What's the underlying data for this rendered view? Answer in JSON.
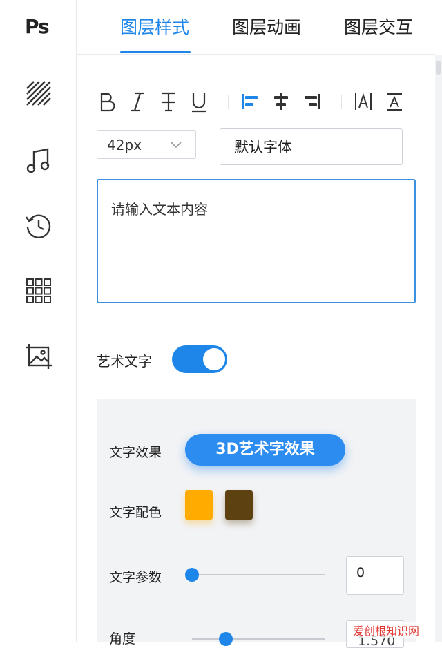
{
  "sidebar": {
    "logo": "Ps",
    "icons": [
      "texture-icon",
      "music-icon",
      "history-icon",
      "grid-icon",
      "image-icon"
    ]
  },
  "tabs": [
    {
      "label": "图层样式",
      "active": true
    },
    {
      "label": "图层动画",
      "active": false
    },
    {
      "label": "图层交互",
      "active": false
    }
  ],
  "toolbar": {
    "buttons": [
      "bold",
      "italic",
      "strikethrough",
      "underline",
      "align-left",
      "align-center",
      "align-right",
      "letter-spacing",
      "line-height"
    ]
  },
  "font": {
    "size": "42px",
    "family": "默认字体"
  },
  "text_input": {
    "placeholder": "请输入文本内容"
  },
  "art_text": {
    "label": "艺术文字",
    "enabled": true
  },
  "panel": {
    "effect_label": "文字效果",
    "effect_button": "3D艺术字效果",
    "color_label": "文字配色",
    "colors": [
      "#ffab00",
      "#5e4110"
    ],
    "param_label": "文字参数",
    "param_value": "0",
    "angle_label": "角度",
    "angle_value": "1.570"
  },
  "colors": {
    "accent": "#1f86e9"
  },
  "watermark": "爱创根知识网"
}
